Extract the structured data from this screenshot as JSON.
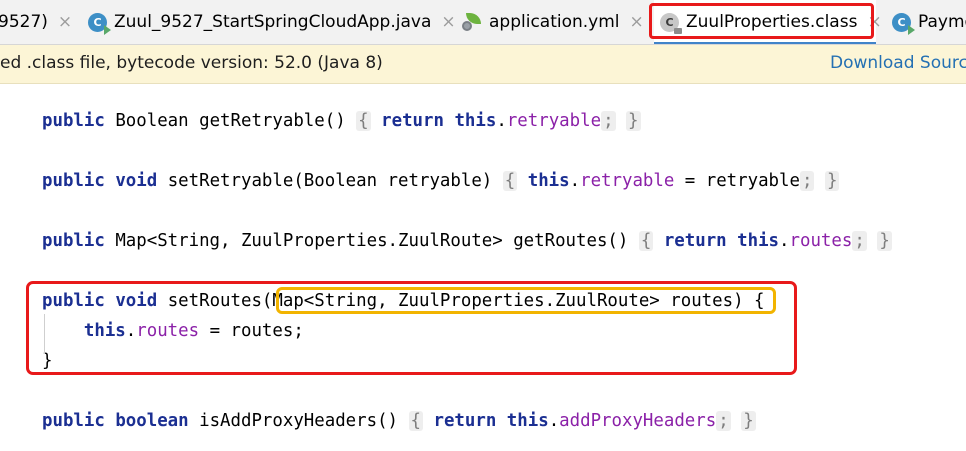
{
  "tabs": [
    {
      "label": "9527)",
      "icon": "none",
      "closable": true,
      "active": false
    },
    {
      "label": "Zuul_9527_StartSpringCloudApp.java",
      "icon": "class-run-icon",
      "closable": true,
      "active": false
    },
    {
      "label": "application.yml",
      "icon": "spring-config-icon",
      "closable": true,
      "active": false
    },
    {
      "label": "ZuulProperties.class",
      "icon": "class-file-icon",
      "closable": true,
      "active": true
    },
    {
      "label": "Payme",
      "icon": "class-run-icon",
      "closable": false,
      "active": false
    }
  ],
  "tab_icon_letter": "C",
  "close_glyph": "×",
  "notification": {
    "message": "ed .class file, bytecode version: 52.0 (Java 8)",
    "link": "Download Source"
  },
  "code": {
    "getRetryable": {
      "mod": "public",
      "type": "Boolean",
      "name": "getRetryable()",
      "open": "{",
      "ret": "return",
      "self": "this",
      "dot": ".",
      "field": "retryable",
      "semi": ";",
      "close": "}"
    },
    "setRetryable": {
      "mod": "public",
      "type": "void",
      "sig": "setRetryable(Boolean retryable)",
      "open": "{",
      "self": "this",
      "dot": ".",
      "field": "retryable",
      "assign": " = retryable",
      "semi": ";",
      "close": "}"
    },
    "getRoutes": {
      "mod": "public",
      "type": "Map<String, ZuulProperties.ZuulRoute>",
      "name": "getRoutes()",
      "open": "{",
      "ret": "return",
      "self": "this",
      "dot": ".",
      "field": "routes",
      "semi": ";",
      "close": "}"
    },
    "setRoutes": {
      "mod": "public",
      "type": "void",
      "name": "setRoutes(",
      "param": "Map<String, ZuulProperties.ZuulRoute> routes",
      "paren": ")",
      "open": "{",
      "self": "this",
      "dot": ".",
      "field": "routes",
      "assign": " = routes;",
      "close": "}"
    },
    "isAddProxyHeaders": {
      "mod": "public",
      "type": "boolean",
      "name": "isAddProxyHeaders()",
      "open": "{",
      "ret": "return",
      "self": "this",
      "dot": ".",
      "field": "addProxyHeaders",
      "semi": ";",
      "close": "}"
    }
  },
  "colors": {
    "keyword": "#1b2f92",
    "field": "#8b21a8",
    "tab_highlight": "#e8191a",
    "param_highlight": "#f2b400",
    "notification_bg": "#fcf5d6",
    "link": "#2470b3"
  }
}
